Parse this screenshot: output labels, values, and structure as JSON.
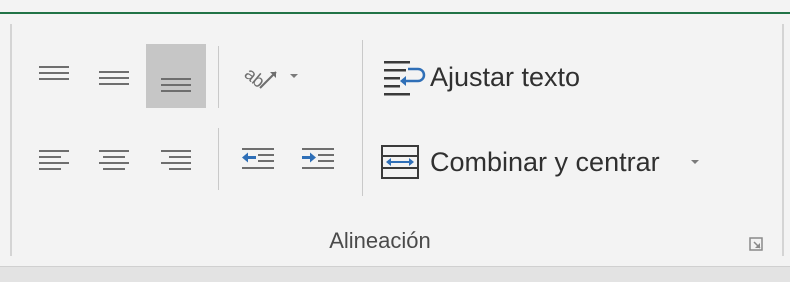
{
  "ribbon": {
    "group_title": "Alineación",
    "accent_color": "#217346",
    "row1": {
      "align_top_icon": "align-top-icon",
      "align_middle_icon": "align-middle-icon",
      "align_bottom_icon": "align-bottom-icon",
      "orientation_icon": "text-orientation-icon",
      "wrap_text_label": "Ajustar texto"
    },
    "row2": {
      "align_left_icon": "align-left-icon",
      "align_center_icon": "align-center-icon",
      "align_right_icon": "align-right-icon",
      "decrease_indent_icon": "decrease-indent-icon",
      "increase_indent_icon": "increase-indent-icon",
      "merge_center_label": "Combinar y centrar"
    },
    "active_button": "align-bottom"
  }
}
